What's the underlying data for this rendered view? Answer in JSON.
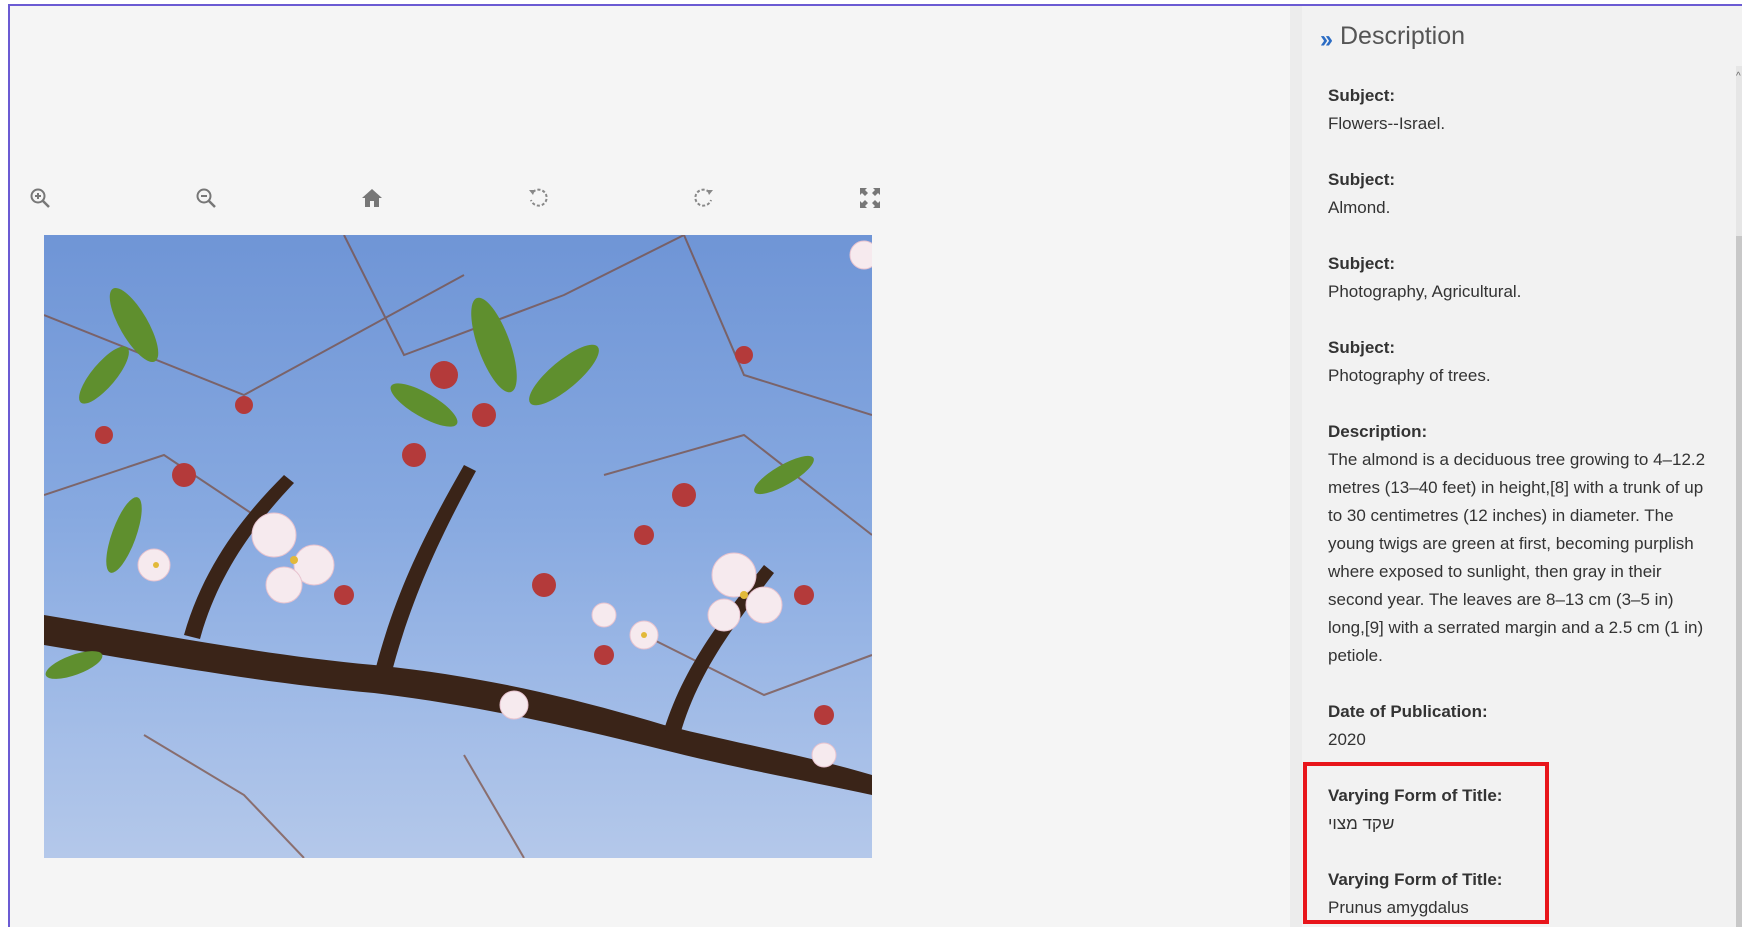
{
  "toolbar": {
    "zoom_in_icon": "zoom-in-icon",
    "zoom_out_icon": "zoom-out-icon",
    "home_icon": "home-icon",
    "rotate_left_icon": "rotate-left-icon",
    "rotate_right_icon": "rotate-right-icon",
    "fullscreen_icon": "fullscreen-icon"
  },
  "image": {
    "subject": "almond-blossom-branch-photo"
  },
  "panel": {
    "title": "Description",
    "fields": [
      {
        "label": "Subject:",
        "value": "Flowers--Israel."
      },
      {
        "label": "Subject:",
        "value": "Almond."
      },
      {
        "label": "Subject:",
        "value": "Photography, Agricultural."
      },
      {
        "label": "Subject:",
        "value": "Photography of trees."
      },
      {
        "label": "Description:",
        "value": "The almond is a deciduous tree growing to 4–12.2 metres (13–40 feet) in height,[8] with a trunk of up to 30 centimetres (12 inches) in diameter. The young twigs are green at first, becoming purplish where exposed to sunlight, then gray in their second year. The leaves are 8–13 cm (3–5 in) long,[9] with a serrated margin and a 2.5 cm (1 in) petiole."
      },
      {
        "label": "Date of Publication:",
        "value": "2020"
      },
      {
        "label": "Varying Form of Title:",
        "value": "שקד מצוי"
      },
      {
        "label": "Varying Form of Title:",
        "value": "Prunus amygdalus"
      }
    ]
  },
  "colors": {
    "accent": "#2b6cc4",
    "highlight": "#e8151b",
    "frame": "#6b5bd3"
  }
}
